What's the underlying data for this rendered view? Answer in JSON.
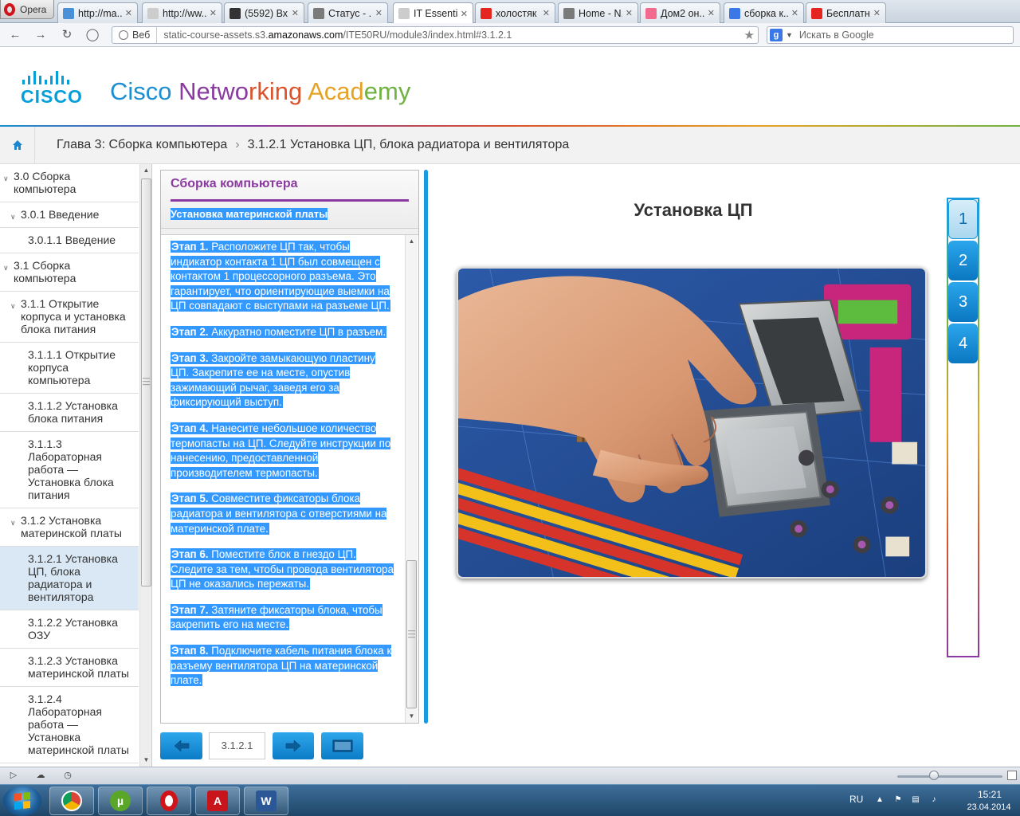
{
  "browser": {
    "menu_label": "Opera",
    "tabs": [
      {
        "title": "http://ma...",
        "favicon_color": "#4a90d9",
        "active": false
      },
      {
        "title": "http://ww...",
        "favicon_color": "#cccccc",
        "active": false
      },
      {
        "title": "(5592) Вх...",
        "favicon_color": "#333333",
        "active": false
      },
      {
        "title": "Статус - ...",
        "favicon_color": "#7a7a7a",
        "active": false
      },
      {
        "title": "IT Essenti...",
        "favicon_color": "#cccccc",
        "active": true
      },
      {
        "title": "холостяк ...",
        "favicon_color": "#e52620",
        "active": false
      },
      {
        "title": "Home - N...",
        "favicon_color": "#7a7a7a",
        "active": false
      },
      {
        "title": "Дом2 он...",
        "favicon_color": "#f26a8d",
        "active": false
      },
      {
        "title": "сборка к...",
        "favicon_color": "#3b78e7",
        "active": false
      },
      {
        "title": "Бесплатн...",
        "favicon_color": "#e52620",
        "active": false
      }
    ],
    "address": {
      "badge": "Веб",
      "url_prefix": "static-course-assets.s3.",
      "url_host": "amazonaws.com",
      "url_rest": "/ITE50RU/module3/index.html#3.1.2.1"
    },
    "search_placeholder": "Искать в Google"
  },
  "header": {
    "logo_text": "CISCO",
    "academy": {
      "p1": "Cisco ",
      "p2": "Netwo",
      "p3": "rking ",
      "p4": "Acad",
      "p5": "emy"
    }
  },
  "breadcrumb": {
    "chapter": "Глава 3: Сборка компьютера",
    "section": "3.1.2.1 Установка ЦП, блока радиатора и вентилятора"
  },
  "sidebar": {
    "items": [
      {
        "label": "3.0 Сборка компьютера",
        "level": 0
      },
      {
        "label": "3.0.1 Введение",
        "level": 1
      },
      {
        "label": "3.0.1.1 Введение",
        "level": 2
      },
      {
        "label": "3.1 Сборка компьютера",
        "level": 0
      },
      {
        "label": "3.1.1 Открытие корпуса и установка блока питания",
        "level": 1
      },
      {
        "label": "3.1.1.1 Открытие корпуса компьютера",
        "level": 2
      },
      {
        "label": "3.1.1.2 Установка блока питания",
        "level": 2
      },
      {
        "label": "3.1.1.3 Лабораторная работа — Установка блока питания",
        "level": 2
      },
      {
        "label": "3.1.2 Установка материнской платы",
        "level": 1
      },
      {
        "label": "3.1.2.1 Установка ЦП, блока радиатора и вентилятора",
        "level": 2,
        "active": true
      },
      {
        "label": "3.1.2.2 Установка ОЗУ",
        "level": 2
      },
      {
        "label": "3.1.2.3 Установка материнской платы",
        "level": 2
      },
      {
        "label": "3.1.2.4 Лабораторная работа — Установка материнской платы",
        "level": 2
      }
    ]
  },
  "panel": {
    "title": "Сборка компьютера",
    "subtitle": "Установка материнской платы",
    "steps": [
      {
        "label": "Этап 1.",
        "text": " Расположите ЦП так, чтобы индикатор контакта 1 ЦП был совмещен с контактом 1 процессорного разъема. Это гарантирует, что ориентирующие выемки на ЦП совпадают с выступами на разъеме ЦП."
      },
      {
        "label": "Этап 2.",
        "text": " Аккуратно поместите ЦП в разъем."
      },
      {
        "label": "Этап 3.",
        "text": " Закройте замыкающую пластину ЦП. Закрепите ее на месте, опустив зажимающий рычаг, заведя его за фиксирующий выступ."
      },
      {
        "label": "Этап 4.",
        "text": " Нанесите небольшое количество термопасты на ЦП. Следуйте инструкции по нанесению, предоставленной производителем термопасты."
      },
      {
        "label": "Этап 5.",
        "text": " Совместите фиксаторы блока радиатора и вентилятора с отверстиями на материнской плате."
      },
      {
        "label": "Этап 6.",
        "text": " Поместите блок в гнездо ЦП. Следите за тем, чтобы провода вентилятора ЦП не оказались пережаты."
      },
      {
        "label": "Этап 7.",
        "text": " Затяните фиксаторы блока, чтобы закрепить его на месте."
      },
      {
        "label": "Этап 8.",
        "text": " Подключите кабель питания блока к разъему вентилятора ЦП на материнской плате."
      }
    ]
  },
  "pager": {
    "page": "3.1.2.1"
  },
  "content": {
    "title": "Установка ЦП",
    "step_tabs": [
      "1",
      "2",
      "3",
      "4"
    ],
    "active_step": 1
  },
  "taskbar": {
    "lang": "RU",
    "time": "15:21",
    "date": "23.04.2014"
  }
}
